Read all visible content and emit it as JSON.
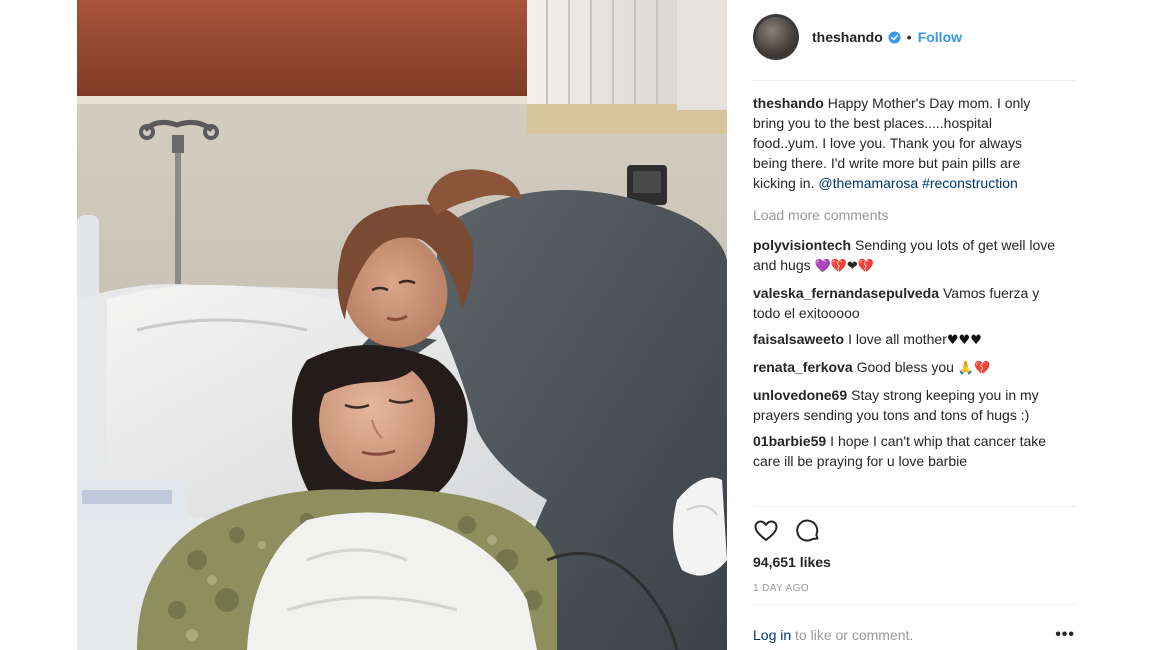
{
  "post": {
    "username": "theshando",
    "follow_label": "Follow",
    "separator": "•",
    "caption": {
      "user": "theshando",
      "text": "Happy Mother's Day mom. I only bring you to the best places.....hospital food..yum. I love you. Thank you for always being there. I'd write more but pain pills are kicking in.",
      "mention": "@themamarosa",
      "hashtag": "#reconstruction"
    },
    "load_more_label": "Load more comments",
    "comments": [
      {
        "user": "polyvisiontech",
        "text": "Sending you lots of get well love and hugs",
        "emoji": "💜💔❤💔"
      },
      {
        "user": "valeska_fernandasepulveda",
        "text": "Vamos fuerza y todo el exitooooo",
        "emoji": ""
      },
      {
        "user": "faisalsaweeto",
        "text": "I love all mother",
        "emoji": "♥♥♥"
      },
      {
        "user": "renata_ferkova",
        "text": "Good bless you",
        "emoji": "🙏💔"
      },
      {
        "user": "unlovedone69",
        "text": "Stay strong keeping you in my prayers sending you tons and tons of hugs :)",
        "emoji": ""
      },
      {
        "user": "01barbie59",
        "text": "I hope I can't whip that cancer take care ill be praying for u love barbie",
        "emoji": ""
      }
    ],
    "likes": "94,651 likes",
    "time_ago": "1 DAY AGO",
    "login_link": "Log in",
    "login_text": " to like or comment.",
    "more_label": "•••"
  },
  "icons": {
    "verified": "verified-badge-icon",
    "like": "heart-outline-icon",
    "comment": "speech-bubble-icon",
    "more": "ellipsis-icon"
  },
  "colors": {
    "link_blue": "#3897f0",
    "dark_link": "#003569",
    "muted": "#999999",
    "text": "#262626"
  }
}
